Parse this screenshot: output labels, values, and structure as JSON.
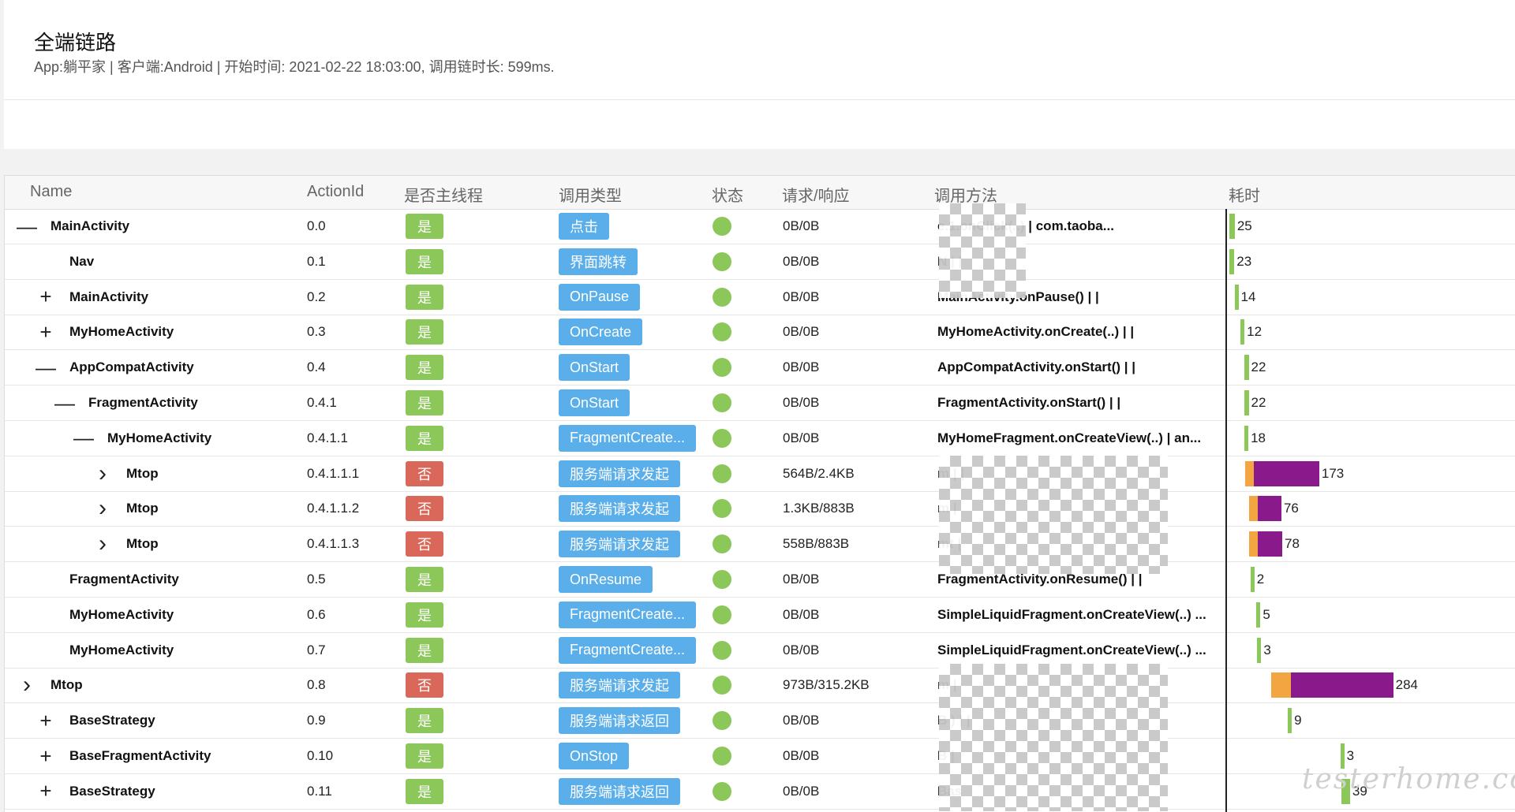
{
  "header": {
    "title": "全端链路",
    "subtitle": "App:躺平家 | 客户端:Android | 开始时间: 2021-02-22 18:03:00, 调用链时长: 599ms."
  },
  "colors": {
    "thread_yes": "#8cc75a",
    "thread_no": "#d9675a",
    "type_badge": "#5aaeea",
    "status_ok": "#8cc75a",
    "bar_local": "#8cc75a",
    "bar_send": "#f2a540",
    "bar_wait": "#8a1a8c"
  },
  "table": {
    "columns": [
      "Name",
      "ActionId",
      "是否主线程",
      "调用类型",
      "状态",
      "请求/响应",
      "调用方法",
      "耗时"
    ],
    "rows": [
      {
        "toggle": "—",
        "depth": 0,
        "name": "MainActivity",
        "action_id": "0.0",
        "main_thread": "是",
        "call_type": "点击",
        "status": "ok",
        "req_resp": "0B/0B",
        "method": "e.1.onClick(..) | com.taoba...",
        "duration": 25,
        "offset": 0,
        "send": 0
      },
      {
        "toggle": "",
        "depth": 1,
        "name": "Nav",
        "action_id": "0.1",
        "main_thread": "是",
        "call_type": "界面跳转",
        "status": "ok",
        "req_resp": "0B/0B",
        "method": "N                  | |",
        "duration": 23,
        "offset": 0,
        "send": 0
      },
      {
        "toggle": "+",
        "depth": 1,
        "name": "MainActivity",
        "action_id": "0.2",
        "main_thread": "是",
        "call_type": "OnPause",
        "status": "ok",
        "req_resp": "0B/0B",
        "method": "MainActivity.onPause() | |",
        "duration": 14,
        "offset": 12,
        "send": 0
      },
      {
        "toggle": "+",
        "depth": 1,
        "name": "MyHomeActivity",
        "action_id": "0.3",
        "main_thread": "是",
        "call_type": "OnCreate",
        "status": "ok",
        "req_resp": "0B/0B",
        "method": "MyHomeActivity.onCreate(..) | |",
        "duration": 12,
        "offset": 26,
        "send": 0
      },
      {
        "toggle": "—",
        "depth": 1,
        "name": "AppCompatActivity",
        "action_id": "0.4",
        "main_thread": "是",
        "call_type": "OnStart",
        "status": "ok",
        "req_resp": "0B/0B",
        "method": "AppCompatActivity.onStart() | |",
        "duration": 22,
        "offset": 34,
        "send": 0
      },
      {
        "toggle": "—",
        "depth": 2,
        "name": "FragmentActivity",
        "action_id": "0.4.1",
        "main_thread": "是",
        "call_type": "OnStart",
        "status": "ok",
        "req_resp": "0B/0B",
        "method": "FragmentActivity.onStart() | |",
        "duration": 22,
        "offset": 34,
        "send": 0
      },
      {
        "toggle": "—",
        "depth": 3,
        "name": "MyHomeActivity",
        "action_id": "0.4.1.1",
        "main_thread": "是",
        "call_type": "FragmentCreate...",
        "status": "ok",
        "req_resp": "0B/0B",
        "method": "MyHomeFragment.onCreateView(..) | an...",
        "duration": 18,
        "offset": 35,
        "send": 0
      },
      {
        "toggle": "›",
        "depth": 4,
        "name": "Mtop",
        "action_id": "0.4.1.1.1",
        "main_thread": "否",
        "call_type": "服务端请求发起",
        "status": "ok",
        "req_resp": "564B/2.4KB",
        "method": "m                              | |",
        "duration": 173,
        "offset": 36,
        "send": 42
      },
      {
        "toggle": "›",
        "depth": 4,
        "name": "Mtop",
        "action_id": "0.4.1.1.2",
        "main_thread": "否",
        "call_type": "服务端请求发起",
        "status": "ok",
        "req_resp": "1.3KB/883B",
        "method": "m                               |",
        "duration": 76,
        "offset": 45,
        "send": 42
      },
      {
        "toggle": "›",
        "depth": 4,
        "name": "Mtop",
        "action_id": "0.4.1.1.3",
        "main_thread": "否",
        "call_type": "服务端请求发起",
        "status": "ok",
        "req_resp": "558B/883B",
        "method": "mt                              |",
        "duration": 78,
        "offset": 45,
        "send": 42
      },
      {
        "toggle": "",
        "depth": 1,
        "name": "FragmentActivity",
        "action_id": "0.5",
        "main_thread": "是",
        "call_type": "OnResume",
        "status": "ok",
        "req_resp": "0B/0B",
        "method": "FragmentActivity.onResume() | |",
        "duration": 2,
        "offset": 49,
        "send": 0
      },
      {
        "toggle": "",
        "depth": 1,
        "name": "MyHomeActivity",
        "action_id": "0.6",
        "main_thread": "是",
        "call_type": "FragmentCreate...",
        "status": "ok",
        "req_resp": "0B/0B",
        "method": "SimpleLiquidFragment.onCreateView(..) ...",
        "duration": 5,
        "offset": 63,
        "send": 0
      },
      {
        "toggle": "",
        "depth": 1,
        "name": "MyHomeActivity",
        "action_id": "0.7",
        "main_thread": "是",
        "call_type": "FragmentCreate...",
        "status": "ok",
        "req_resp": "0B/0B",
        "method": "SimpleLiquidFragment.onCreateView(..) ...",
        "duration": 3,
        "offset": 65,
        "send": 0
      },
      {
        "toggle": "›",
        "depth": 0,
        "name": "Mtop",
        "action_id": "0.8",
        "main_thread": "否",
        "call_type": "服务端请求发起",
        "status": "ok",
        "req_resp": "973B/315.2KB",
        "method": "m                              |",
        "duration": 284,
        "offset": 97,
        "send": 92
      },
      {
        "toggle": "+",
        "depth": 1,
        "name": "BaseStrategy",
        "action_id": "0.9",
        "main_thread": "是",
        "call_type": "服务端请求返回",
        "status": "ok",
        "req_resp": "0B/0B",
        "method": "B                          ) | |",
        "duration": 9,
        "offset": 136,
        "send": 0
      },
      {
        "toggle": "+",
        "depth": 1,
        "name": "BaseFragmentActivity",
        "action_id": "0.10",
        "main_thread": "是",
        "call_type": "OnStop",
        "status": "ok",
        "req_resp": "0B/0B",
        "method": "B                              |",
        "duration": 3,
        "offset": 258,
        "send": 0
      },
      {
        "toggle": "+",
        "depth": 1,
        "name": "BaseStrategy",
        "action_id": "0.11",
        "main_thread": "是",
        "call_type": "服务端请求返回",
        "status": "ok",
        "req_resp": "0B/0B",
        "method": "Bas",
        "duration": 39,
        "offset": 261,
        "send": 0
      }
    ]
  },
  "watermark": "testerhome.com"
}
